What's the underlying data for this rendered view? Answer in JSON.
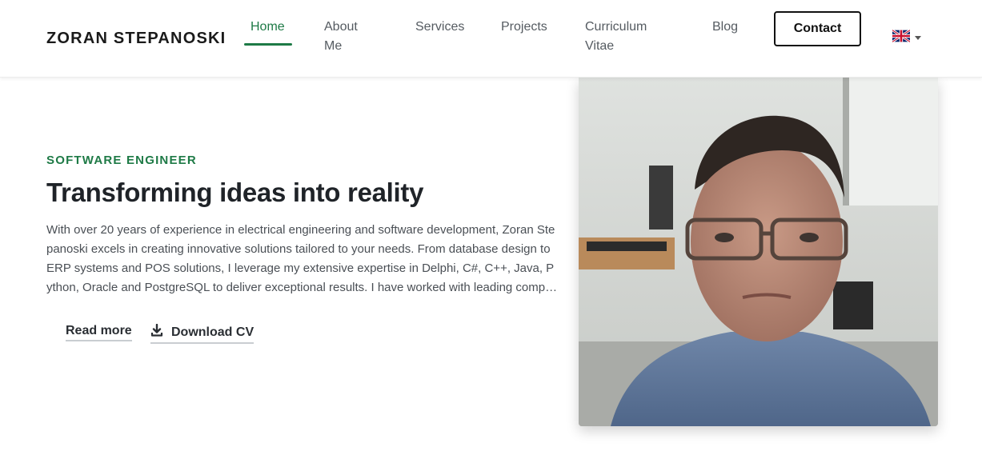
{
  "header": {
    "brand": "ZORAN STEPANOSKI",
    "nav": [
      {
        "label": "Home",
        "active": true
      },
      {
        "label": "About\nMe",
        "active": false
      },
      {
        "label": "Services",
        "active": false
      },
      {
        "label": "Projects",
        "active": false
      },
      {
        "label": "Curriculum\nVitae",
        "active": false
      },
      {
        "label": "Blog",
        "active": false
      }
    ],
    "contact_label": "Contact",
    "language_icon": "uk-flag-icon"
  },
  "hero": {
    "eyebrow": "SOFTWARE ENGINEER",
    "headline": "Transforming ideas into reality",
    "intro": "With over 20 years of experience in electrical engineering and software development, Zoran Stepanoski excels in creating innovative solutions tailored to your needs. From database design to ERP systems and POS solutions, I leverage my extensive expertise in Delphi, C#, C++, Java, Python, Oracle and PostgreSQL to deliver exceptional results. I have worked with leading compani...",
    "read_more_label": "Read more",
    "download_cv_label": "Download CV",
    "download_icon": "download-icon"
  },
  "colors": {
    "accent": "#1e7a46",
    "text": "#1f2328"
  }
}
